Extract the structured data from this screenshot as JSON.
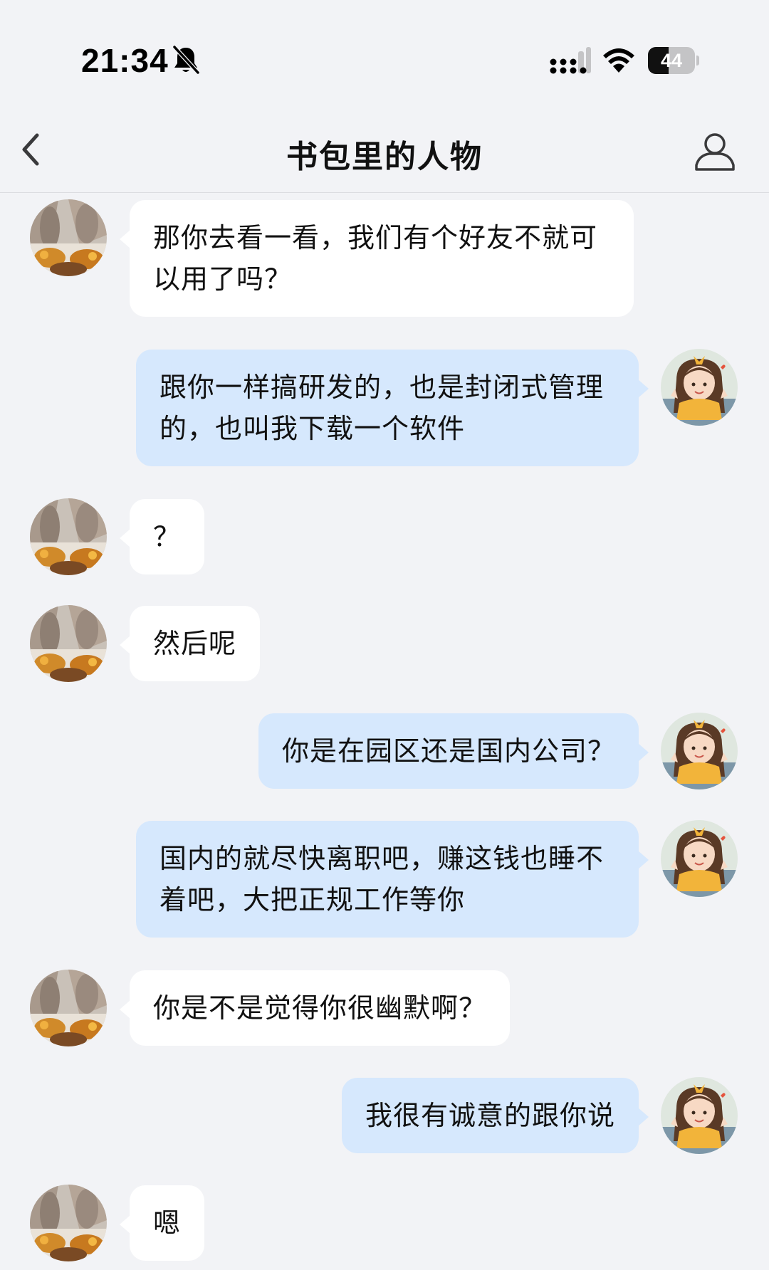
{
  "status_bar": {
    "time": "21:34",
    "silent_icon": "bell-slash-icon",
    "signal_icon": "cellular-signal-icon",
    "wifi_icon": "wifi-icon",
    "battery_level": 44,
    "battery_text": "44"
  },
  "header": {
    "back_icon": "chevron-left-icon",
    "title": "书包里的人物",
    "profile_icon": "person-outline-icon"
  },
  "messages": [
    {
      "sender": "contact",
      "text": "那你去看一看，我们有个好友不就可以用了吗？"
    },
    {
      "sender": "me",
      "text": "跟你一样搞研发的，也是封闭式管理的，也叫我下载一个软件"
    },
    {
      "sender": "contact",
      "text": "？"
    },
    {
      "sender": "contact",
      "text": "然后呢"
    },
    {
      "sender": "me",
      "text": "你是在园区还是国内公司？"
    },
    {
      "sender": "me",
      "text": "国内的就尽快离职吧，赚这钱也睡不着吧，大把正规工作等你"
    },
    {
      "sender": "contact",
      "text": "你是不是觉得你很幽默啊？"
    },
    {
      "sender": "me",
      "text": "我很有诚意的跟你说"
    },
    {
      "sender": "contact",
      "text": "嗯"
    }
  ],
  "colors": {
    "background": "#f2f3f6",
    "incoming_bubble": "#ffffff",
    "outgoing_bubble": "#d6e8fd"
  }
}
